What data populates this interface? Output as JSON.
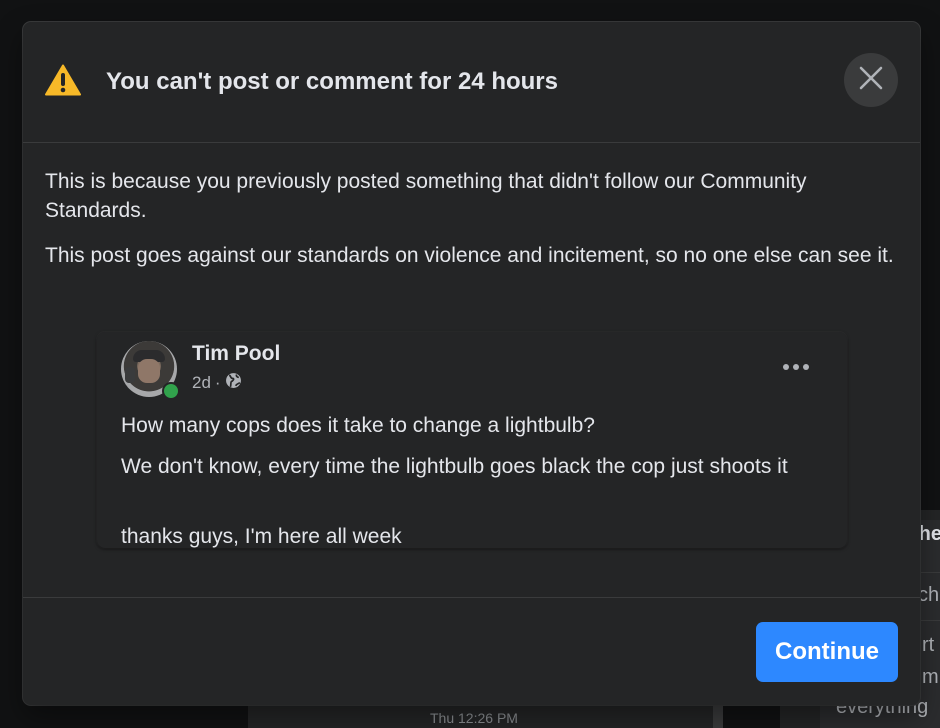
{
  "dialog": {
    "title": "You can't post or comment for 24 hours",
    "paragraphs": [
      "This is because you previously posted something that didn't follow our Community Standards.",
      "This post goes against our standards on violence and incitement, so no one else can see it."
    ],
    "continue_label": "Continue",
    "icons": {
      "warning": "warning-triangle-icon",
      "close": "close-icon"
    },
    "colors": {
      "warning": "#f7b928",
      "accent": "#2d88ff",
      "online": "#31a24c"
    }
  },
  "post": {
    "author": "Tim Pool",
    "time": "2d",
    "separator": "·",
    "visibility_icon": "globe-icon",
    "lines": [
      "How many cops does it take to change a lightbulb?",
      "We don't know, every time the lightbulb goes black the cop just shoots it",
      "thanks guys, I'm here all week"
    ]
  },
  "background": {
    "timestamp": "Thu 12:26 PM",
    "right_fragments": [
      "ther",
      "ch",
      "rt",
      "m",
      "everything"
    ]
  }
}
